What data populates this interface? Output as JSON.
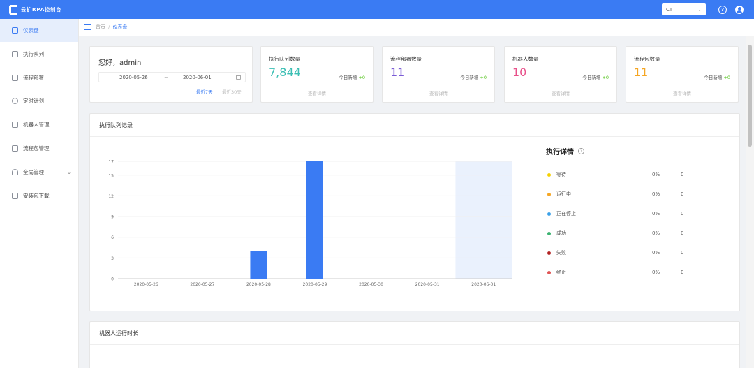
{
  "header": {
    "logo_text": "云扩RPA控制台",
    "user_select": "CT"
  },
  "sidebar": {
    "items": [
      {
        "label": "仪表盘",
        "icon": "dashboard-icon"
      },
      {
        "label": "执行队列",
        "icon": "queue-icon"
      },
      {
        "label": "流程部署",
        "icon": "deploy-icon"
      },
      {
        "label": "定时计划",
        "icon": "clock-icon"
      },
      {
        "label": "机器人管理",
        "icon": "robot-icon"
      },
      {
        "label": "流程包管理",
        "icon": "package-icon"
      },
      {
        "label": "全局管理",
        "icon": "user-settings-icon"
      },
      {
        "label": "安装包下载",
        "icon": "download-icon"
      }
    ]
  },
  "breadcrumb": {
    "home": "首页",
    "current": "仪表盘"
  },
  "welcome": {
    "greeting": "您好，admin",
    "date_start": "2020-05-26",
    "date_sep": "~",
    "date_end": "2020-06-01",
    "quick_7days": "最近7天",
    "quick_30days": "最近30天"
  },
  "stats": [
    {
      "title": "执行队列数量",
      "value": "7,844",
      "today_label": "今日新增",
      "today_value": "+0",
      "link": "查看详情",
      "color": "#3cbfb4"
    },
    {
      "title": "流程部署数量",
      "value": "11",
      "today_label": "今日新增",
      "today_value": "+0",
      "link": "查看详情",
      "color": "#7b5cd6"
    },
    {
      "title": "机器人数量",
      "value": "10",
      "today_label": "今日新增",
      "today_value": "+0",
      "link": "查看详情",
      "color": "#e8508a"
    },
    {
      "title": "流程包数量",
      "value": "11",
      "today_label": "今日新增",
      "today_value": "+0",
      "link": "查看详情",
      "color": "#f5a623"
    }
  ],
  "queue_card": {
    "title": "执行队列记录",
    "detail_title": "执行详情",
    "detail": [
      {
        "label": "等待",
        "percent": "0%",
        "count": "0",
        "color": "#f5d000"
      },
      {
        "label": "运行中",
        "percent": "0%",
        "count": "0",
        "color": "#f5a623"
      },
      {
        "label": "正在停止",
        "percent": "0%",
        "count": "0",
        "color": "#3aa0e8"
      },
      {
        "label": "成功",
        "percent": "0%",
        "count": "0",
        "color": "#3cb371"
      },
      {
        "label": "失败",
        "percent": "0%",
        "count": "0",
        "color": "#b22222"
      },
      {
        "label": "终止",
        "percent": "0%",
        "count": "0",
        "color": "#e05555"
      }
    ]
  },
  "runtime_card": {
    "title": "机器人运行时长"
  },
  "chart_data": {
    "type": "bar",
    "categories": [
      "2020-05-26",
      "2020-05-27",
      "2020-05-28",
      "2020-05-29",
      "2020-05-30",
      "2020-05-31",
      "2020-06-01"
    ],
    "values": [
      0,
      0,
      4,
      17,
      0,
      0,
      0
    ],
    "yticks": [
      0,
      3,
      6,
      9,
      12,
      15,
      17
    ],
    "ylim": [
      0,
      17
    ],
    "highlighted_category": "2020-06-01",
    "bar_color": "#3a7bf3",
    "grid": true
  }
}
